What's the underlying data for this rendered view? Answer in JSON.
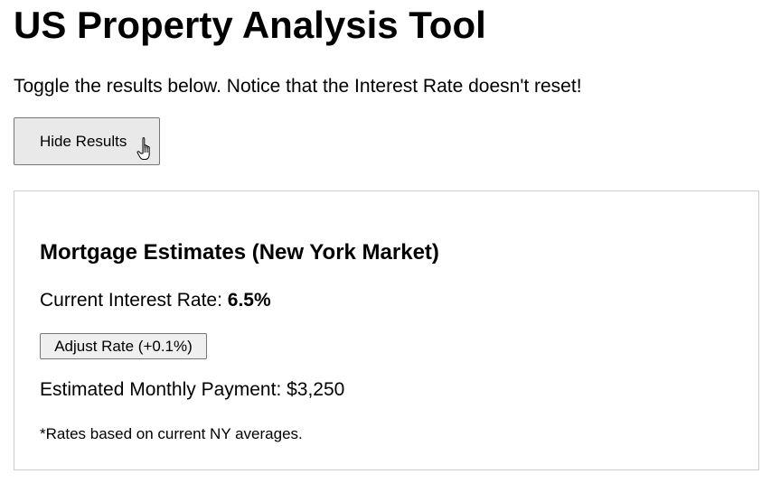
{
  "page": {
    "title": "US Property Analysis Tool",
    "intro": "Toggle the results below. Notice that the Interest Rate doesn't reset!"
  },
  "toggle": {
    "label": "Hide Results"
  },
  "results": {
    "heading": "Mortgage Estimates (New York Market)",
    "rate_label": "Current Interest Rate: ",
    "rate_value": "6.5%",
    "adjust_label": "Adjust Rate (+0.1%)",
    "payment_text": "Estimated Monthly Payment: $3,250",
    "footnote": "*Rates based on current NY averages."
  },
  "cursor": {
    "icon": "hand-pointer-icon"
  }
}
